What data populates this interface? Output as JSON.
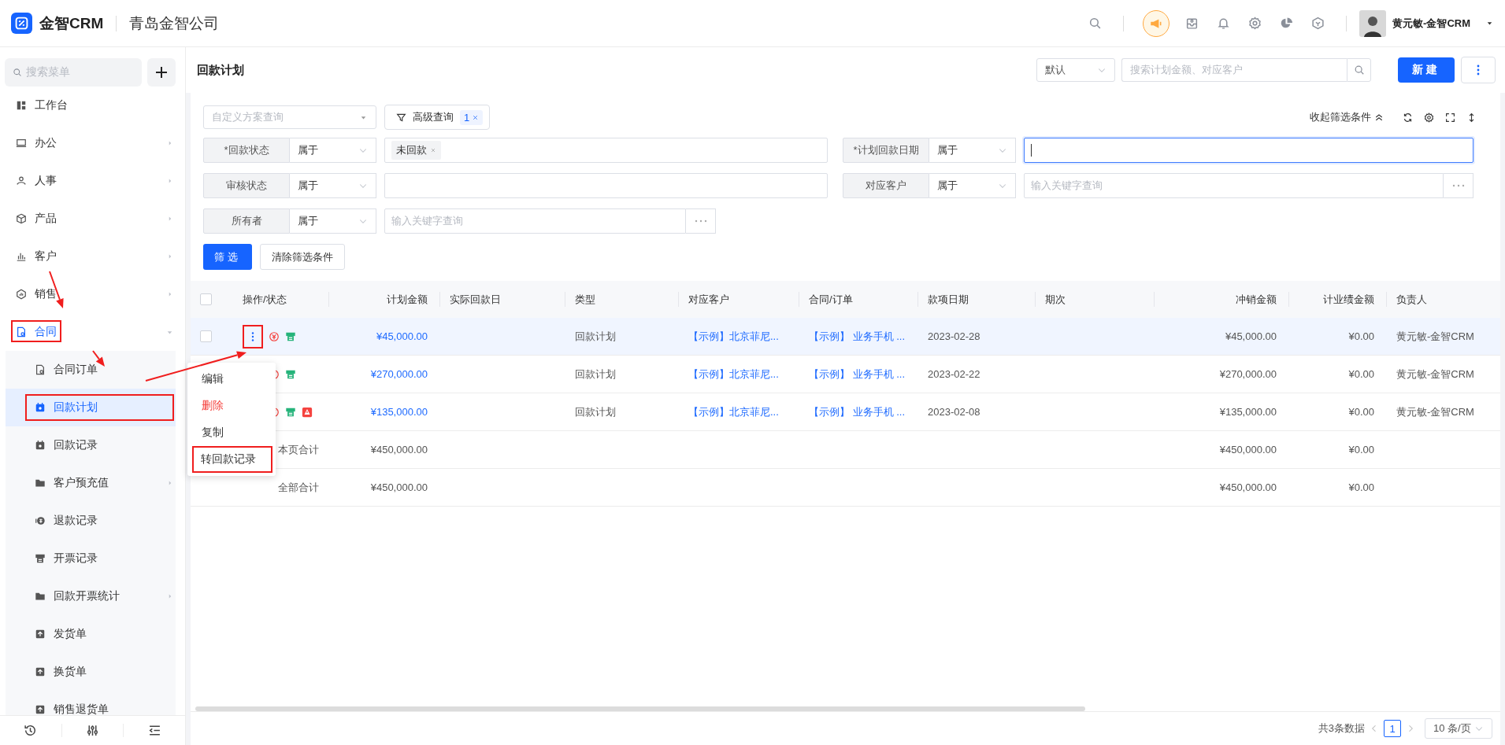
{
  "app": {
    "logo_text": "金智CRM",
    "company": "青岛金智公司",
    "user_name": "黄元敏-金智CRM"
  },
  "sidebar": {
    "search_placeholder": "搜索菜单",
    "items": [
      {
        "label": "工作台",
        "has_children": false,
        "expanded": false,
        "annotated": false
      },
      {
        "label": "办公",
        "has_children": true,
        "expanded": false,
        "annotated": false
      },
      {
        "label": "人事",
        "has_children": true,
        "expanded": false,
        "annotated": false
      },
      {
        "label": "产品",
        "has_children": true,
        "expanded": false,
        "annotated": false
      },
      {
        "label": "客户",
        "has_children": true,
        "expanded": false,
        "annotated": false
      },
      {
        "label": "销售",
        "has_children": true,
        "expanded": false,
        "annotated": false
      },
      {
        "label": "合同",
        "has_children": true,
        "expanded": true,
        "annotated": true,
        "children": [
          {
            "label": "合同订单",
            "selected": false,
            "has_children": false,
            "annotated": false
          },
          {
            "label": "回款计划",
            "selected": true,
            "has_children": false,
            "annotated": true
          },
          {
            "label": "回款记录",
            "selected": false,
            "has_children": false,
            "annotated": false
          },
          {
            "label": "客户预充值",
            "selected": false,
            "has_children": true,
            "annotated": false
          },
          {
            "label": "退款记录",
            "selected": false,
            "has_children": false,
            "annotated": false
          },
          {
            "label": "开票记录",
            "selected": false,
            "has_children": false,
            "annotated": false
          },
          {
            "label": "回款开票统计",
            "selected": false,
            "has_children": true,
            "annotated": false
          },
          {
            "label": "发货单",
            "selected": false,
            "has_children": false,
            "annotated": false
          },
          {
            "label": "换货单",
            "selected": false,
            "has_children": false,
            "annotated": false
          },
          {
            "label": "销售退货单",
            "selected": false,
            "has_children": false,
            "annotated": false
          }
        ]
      }
    ]
  },
  "page_header": {
    "title": "回款计划",
    "view_select": "默认",
    "search_placeholder": "搜索计划金额、对应客户",
    "new_button": "新建"
  },
  "filter_bar": {
    "scheme_placeholder": "自定义方案查询",
    "advanced_button": "高级查询",
    "advanced_count": "1",
    "collapse_label": "收起筛选条件"
  },
  "filters": [
    {
      "label": "*回款状态",
      "operator": "属于",
      "tags": [
        "未回款"
      ],
      "picker": false,
      "focused": false
    },
    {
      "label": "*计划回款日期",
      "operator": "属于",
      "picker": false,
      "focused": true
    },
    {
      "label": "审核状态",
      "operator": "属于",
      "picker": false,
      "focused": false
    },
    {
      "label": "对应客户",
      "operator": "属于",
      "placeholder": "输入关键字查询",
      "picker": true,
      "focused": false
    },
    {
      "label": "所有者",
      "operator": "属于",
      "placeholder": "输入关键字查询",
      "picker": true,
      "focused": false
    }
  ],
  "filter_actions": {
    "apply": "筛选",
    "clear": "清除筛选条件"
  },
  "table": {
    "columns": [
      "操作/状态",
      "计划金额",
      "实际回款日",
      "类型",
      "对应客户",
      "合同/订单",
      "款项日期",
      "期次",
      "冲销金额",
      "计业绩金额",
      "负责人"
    ],
    "header_checkbox": {
      "checked": false
    },
    "rows": [
      {
        "kind": "data",
        "highlighted": true,
        "checkbox": {
          "checked": false
        },
        "menu_button": {
          "annotated": true
        },
        "statuses": [
          {
            "kind": "payment"
          },
          {
            "kind": "invoice"
          }
        ],
        "cells": [
          null,
          {
            "text": "¥45,000.00",
            "link": true
          },
          null,
          "回款计划",
          {
            "text": "【示例】北京菲尼...",
            "link": true
          },
          {
            "text": "【示例】 业务手机 ...",
            "link": true
          },
          "2023-02-28",
          null,
          "¥45,000.00",
          "¥0.00",
          "黄元敏-金智CRM"
        ]
      },
      {
        "kind": "data",
        "highlighted": false,
        "statuses": [
          {
            "kind": "payment"
          },
          {
            "kind": "invoice"
          }
        ],
        "cells": [
          null,
          {
            "text": "¥270,000.00",
            "link": true
          },
          null,
          "回款计划",
          {
            "text": "【示例】北京菲尼...",
            "link": true
          },
          {
            "text": "【示例】 业务手机 ...",
            "link": true
          },
          "2023-02-22",
          null,
          "¥270,000.00",
          "¥0.00",
          "黄元敏-金智CRM"
        ]
      },
      {
        "kind": "data",
        "highlighted": false,
        "statuses": [
          {
            "kind": "payment"
          },
          {
            "kind": "invoice"
          },
          {
            "kind": "warning"
          }
        ],
        "cells": [
          null,
          {
            "text": "¥135,000.00",
            "link": true
          },
          null,
          "回款计划",
          {
            "text": "【示例】北京菲尼...",
            "link": true
          },
          {
            "text": "【示例】 业务手机 ...",
            "link": true
          },
          "2023-02-08",
          null,
          "¥135,000.00",
          "¥0.00",
          "黄元敏-金智CRM"
        ]
      },
      {
        "kind": "total",
        "highlighted": false,
        "cells": [
          "本页合计",
          "¥450,000.00",
          null,
          null,
          null,
          null,
          null,
          null,
          "¥450,000.00",
          "¥0.00",
          null
        ]
      },
      {
        "kind": "total",
        "highlighted": false,
        "cells": [
          "全部合计",
          "¥450,000.00",
          null,
          null,
          null,
          null,
          null,
          null,
          "¥450,000.00",
          "¥0.00",
          null
        ]
      }
    ]
  },
  "row_menu": {
    "items": [
      {
        "label": "编辑",
        "kind": "normal",
        "annotated": false
      },
      {
        "label": "删除",
        "kind": "danger",
        "annotated": false
      },
      {
        "label": "复制",
        "kind": "normal",
        "annotated": false
      },
      {
        "label": "转回款记录",
        "kind": "normal",
        "annotated": true
      }
    ]
  },
  "pagination": {
    "total": "共3条数据",
    "pages": [
      {
        "label": "1",
        "selected": true
      }
    ],
    "page_size": "10 条/页"
  }
}
